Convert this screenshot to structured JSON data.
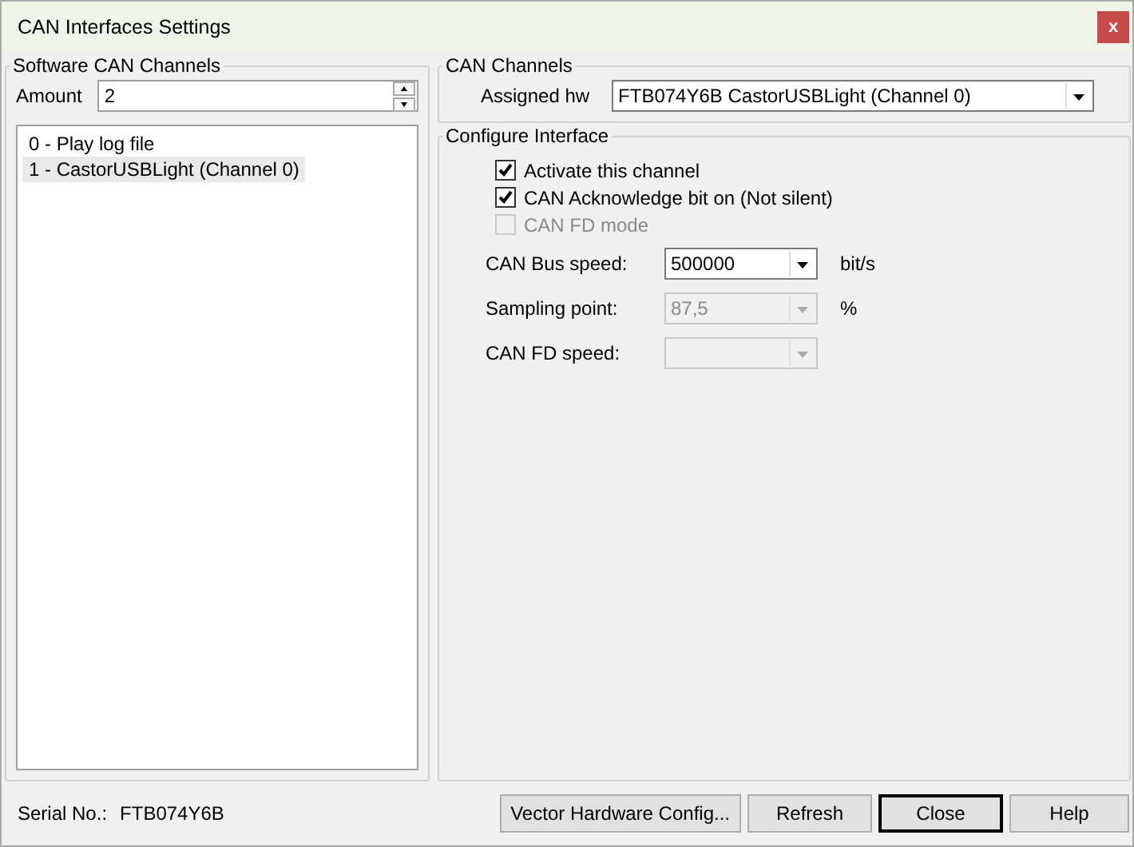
{
  "window": {
    "title": "CAN Interfaces Settings",
    "close": "x"
  },
  "software_channels": {
    "title": "Software CAN Channels",
    "amount_label": "Amount",
    "amount": "2",
    "items": [
      {
        "label": "0 - Play log file",
        "selected": false
      },
      {
        "label": "1 - CastorUSBLight (Channel 0)",
        "selected": true
      }
    ]
  },
  "can_channels": {
    "title": "CAN Channels",
    "assigned_label": "Assigned hw",
    "assigned": "FTB074Y6B CastorUSBLight (Channel 0)"
  },
  "configure": {
    "title": "Configure Interface",
    "checkboxes": [
      {
        "label": "Activate this channel",
        "checked": true,
        "disabled": false
      },
      {
        "label": "CAN Acknowledge bit on (Not silent)",
        "checked": true,
        "disabled": false
      },
      {
        "label": "CAN FD mode",
        "checked": false,
        "disabled": true
      }
    ],
    "fields": [
      {
        "label": "CAN Bus speed:",
        "value": "500000",
        "unit": "bit/s",
        "disabled": false
      },
      {
        "label": "Sampling point:",
        "value": "87,5",
        "unit": "%",
        "disabled": true
      },
      {
        "label": "CAN FD speed:",
        "disabled": true
      }
    ]
  },
  "status": {
    "serial_label": "Serial No.:",
    "serial": "FTB074Y6B"
  },
  "buttons": [
    {
      "label": "Vector Hardware Config...",
      "default": false
    },
    {
      "label": "Refresh",
      "default": false
    },
    {
      "label": "Close",
      "default": true
    },
    {
      "label": "Help",
      "default": false
    }
  ]
}
